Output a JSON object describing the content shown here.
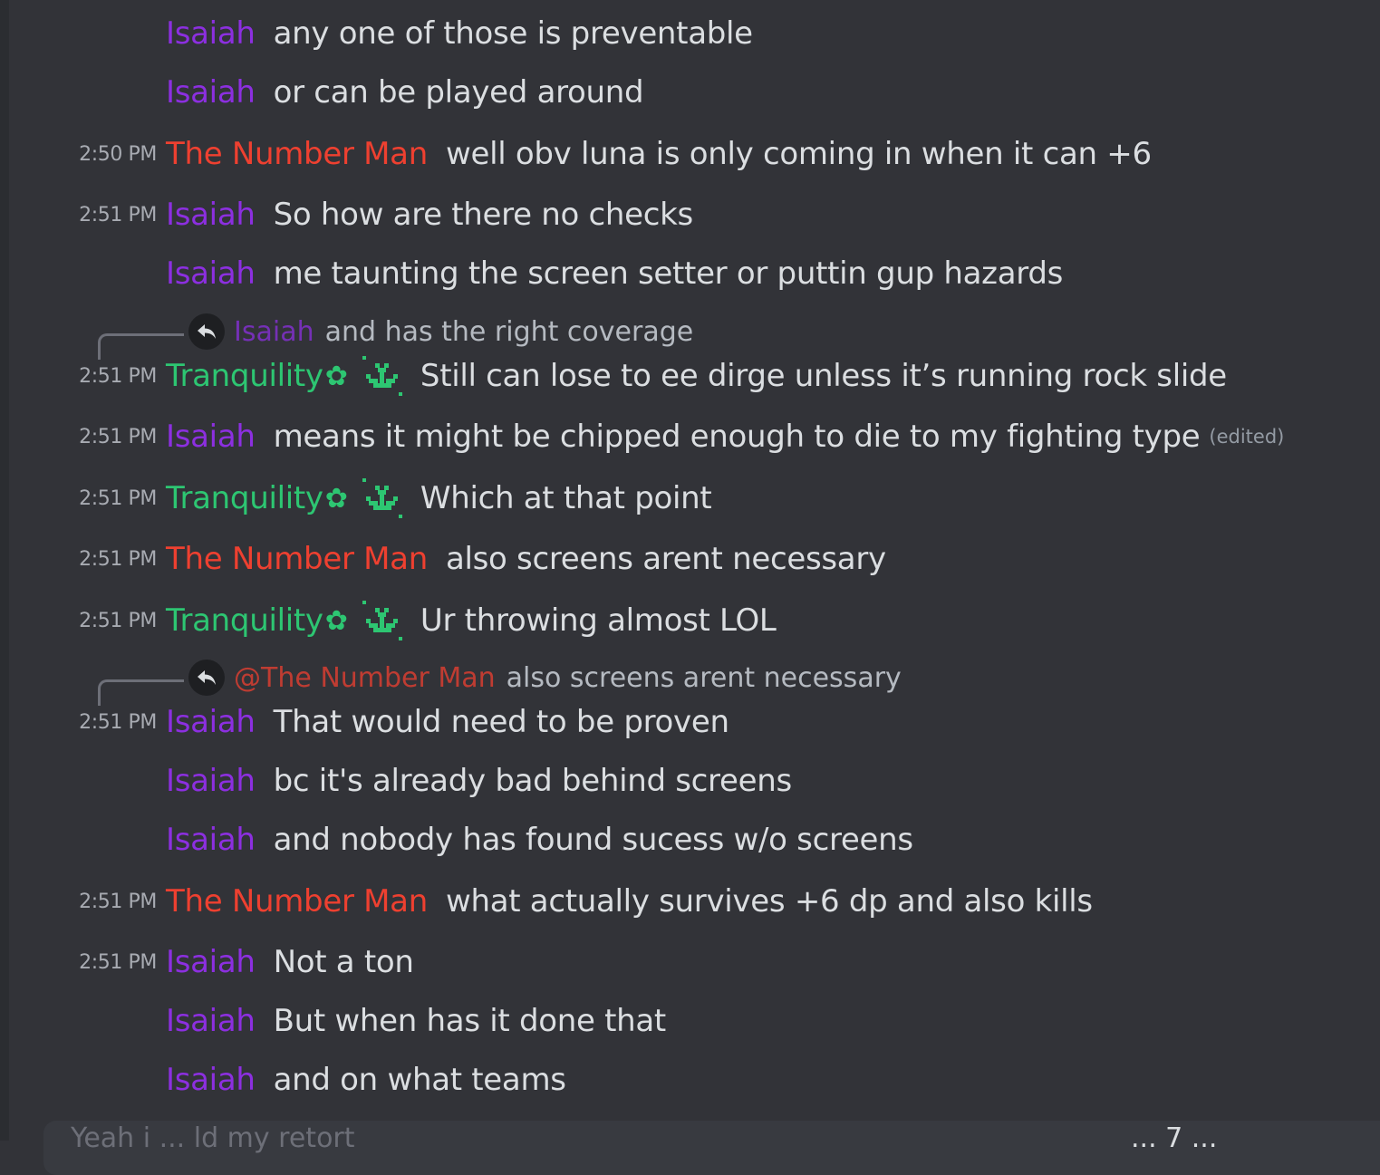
{
  "colors": {
    "background": "#323338",
    "isaiah": "#8c2fe0",
    "the_number_man": "#ee4030",
    "tranquility": "#2dc672",
    "message_text": "#dbdee1",
    "timestamp": "#a8abb2"
  },
  "messages": [
    {
      "timestamp": "",
      "author": "Isaiah",
      "text": "any one of those is preventable"
    },
    {
      "timestamp": "",
      "author": "Isaiah",
      "text": "or can be played around"
    },
    {
      "timestamp": "2:50 PM",
      "author": "The Number Man",
      "text": "well obv luna is only coming in when it can +6"
    },
    {
      "timestamp": "2:51 PM",
      "author": "Isaiah",
      "text": "So how are there no checks"
    },
    {
      "timestamp": "",
      "author": "Isaiah",
      "text": "me taunting the screen setter or puttin gup hazards"
    },
    {
      "reply": {
        "author": "Isaiah",
        "text": "and has the right coverage"
      },
      "timestamp": "2:51 PM",
      "author": "Tranquility",
      "flower": "✿",
      "text": "Still can lose to ee dirge unless it’s running rock slide"
    },
    {
      "timestamp": "2:51 PM",
      "author": "Isaiah",
      "text": "means it might be chipped enough to die to my fighting type",
      "edited": "(edited)"
    },
    {
      "timestamp": "2:51 PM",
      "author": "Tranquility",
      "flower": "✿",
      "text": "Which at that point"
    },
    {
      "timestamp": "2:51 PM",
      "author": "The Number Man",
      "text": "also screens arent necessary"
    },
    {
      "timestamp": "2:51 PM",
      "author": "Tranquility",
      "flower": "✿",
      "text": "Ur throwing almost LOL"
    },
    {
      "reply": {
        "author": "@The Number Man",
        "text": "also screens arent necessary"
      },
      "timestamp": "2:51 PM",
      "author": "Isaiah",
      "text": "That would need to be proven"
    },
    {
      "timestamp": "",
      "author": "Isaiah",
      "text": "bc it's already bad behind screens"
    },
    {
      "timestamp": "",
      "author": "Isaiah",
      "text": "and nobody has found sucess w/o screens"
    },
    {
      "timestamp": "2:51 PM",
      "author": "The Number Man",
      "text": "what actually survives +6 dp and also kills"
    },
    {
      "timestamp": "2:51 PM",
      "author": "Isaiah",
      "text": "Not a ton"
    },
    {
      "timestamp": "",
      "author": "Isaiah",
      "text": "But when has it done that"
    },
    {
      "timestamp": "",
      "author": "Isaiah",
      "text": "and on what teams"
    }
  ],
  "composer": {
    "typing_text": "Yeah i ... ld my retort",
    "right_text": "... 7 ..."
  }
}
